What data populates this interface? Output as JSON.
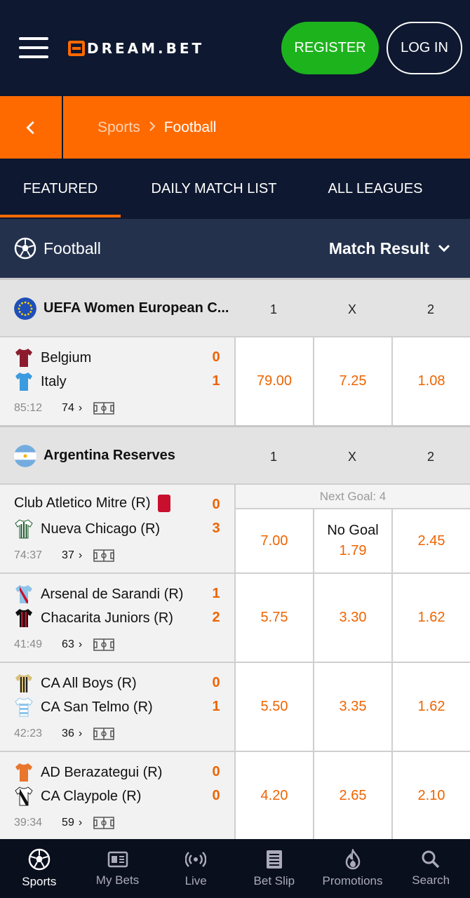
{
  "header": {
    "logo_text": "DREAM.BET",
    "register_label": "REGISTER",
    "login_label": "LOG IN"
  },
  "breadcrumb": {
    "parent": "Sports",
    "current": "Football"
  },
  "tabs": [
    {
      "label": "FEATURED",
      "active": true
    },
    {
      "label": "DAILY MATCH LIST",
      "active": false
    },
    {
      "label": "ALL LEAGUES",
      "active": false
    }
  ],
  "sport_header": {
    "title": "Football",
    "market": "Match Result"
  },
  "columns": [
    "1",
    "X",
    "2"
  ],
  "leagues": [
    {
      "name": "UEFA Women European C...",
      "flag_icon": "eu-flag-icon",
      "matches": [
        {
          "home": "Belgium",
          "away": "Italy",
          "home_score": "0",
          "away_score": "1",
          "time": "85:12",
          "markets_count": "74",
          "odds": [
            "79.00",
            "7.25",
            "1.08"
          ]
        }
      ]
    },
    {
      "name": "Argentina Reserves",
      "flag_icon": "argentina-flag-icon",
      "matches": [
        {
          "home": "Club Atletico Mitre (R)",
          "away": "Nueva Chicago (R)",
          "home_score": "0",
          "away_score": "3",
          "time": "74:37",
          "markets_count": "37",
          "next_goal": "Next Goal: 4",
          "odds": [
            "7.00",
            "1.79",
            "2.45"
          ],
          "middle_label": "No Goal"
        },
        {
          "home": "Arsenal de Sarandi (R)",
          "away": "Chacarita Juniors (R)",
          "home_score": "1",
          "away_score": "2",
          "time": "41:49",
          "markets_count": "63",
          "odds": [
            "5.75",
            "3.30",
            "1.62"
          ]
        },
        {
          "home": "CA All Boys (R)",
          "away": "CA San Telmo (R)",
          "home_score": "0",
          "away_score": "1",
          "time": "42:23",
          "markets_count": "36",
          "odds": [
            "5.50",
            "3.35",
            "1.62"
          ]
        },
        {
          "home": "AD Berazategui (R)",
          "away": "CA Claypole (R)",
          "home_score": "0",
          "away_score": "0",
          "time": "39:34",
          "markets_count": "59",
          "odds": [
            "4.20",
            "2.65",
            "2.10"
          ]
        }
      ]
    }
  ],
  "bottom_nav": [
    {
      "label": "Sports",
      "icon": "football-icon",
      "active": true
    },
    {
      "label": "My Bets",
      "icon": "ticket-icon",
      "active": false
    },
    {
      "label": "Live",
      "icon": "live-icon",
      "active": false
    },
    {
      "label": "Bet Slip",
      "icon": "betslip-icon",
      "active": false
    },
    {
      "label": "Promotions",
      "icon": "flame-icon",
      "active": false
    },
    {
      "label": "Search",
      "icon": "search-icon",
      "active": false
    }
  ],
  "colors": {
    "navy": "#0e1830",
    "orange": "#ff6a00",
    "green": "#1db31d",
    "odds": "#ee6400"
  }
}
